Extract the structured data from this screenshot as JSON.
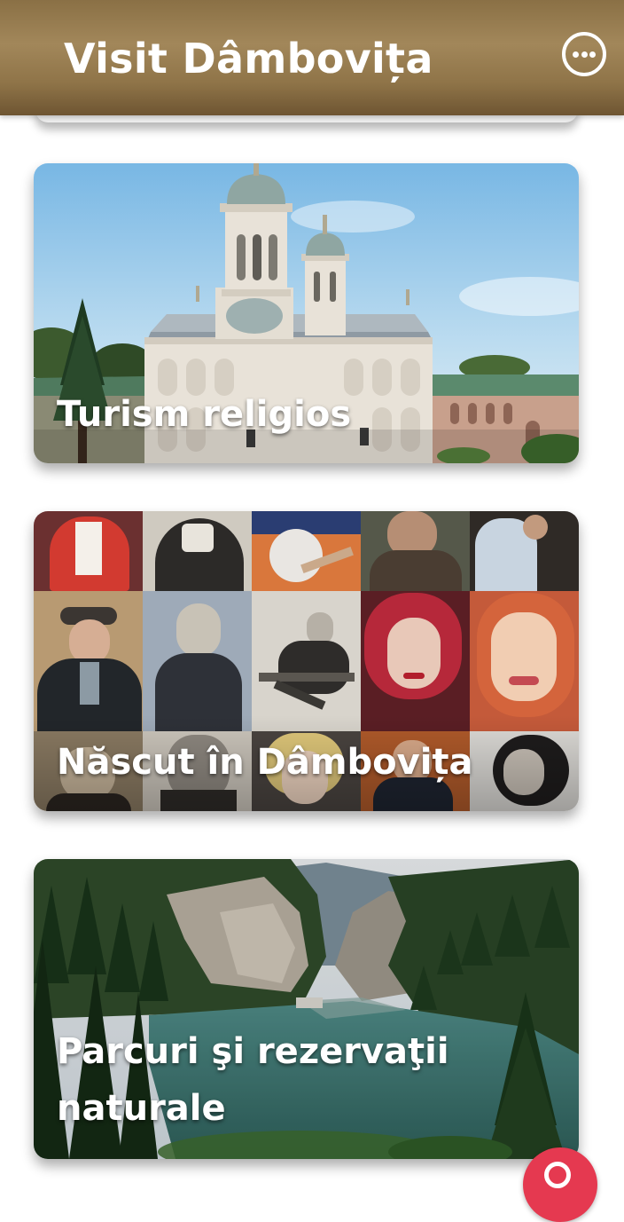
{
  "app_bar": {
    "title": "Visit Dâmbovița",
    "menu_icon": "more-horizontal-circle-icon"
  },
  "cards": [
    {
      "label": "Turism religios",
      "image": "monastery-photo"
    },
    {
      "label": "Născut în Dâmbovița",
      "image": "portrait-mosaic"
    },
    {
      "label_line1": "Parcuri şi rezervaţii",
      "label_line2": "naturale",
      "image": "mountain-lake-photo"
    }
  ],
  "fab": {
    "icon": "chat-icon"
  },
  "colors": {
    "app_bar": "#9a7e52",
    "fab": "#e53950",
    "label_text": "#ffffff"
  }
}
